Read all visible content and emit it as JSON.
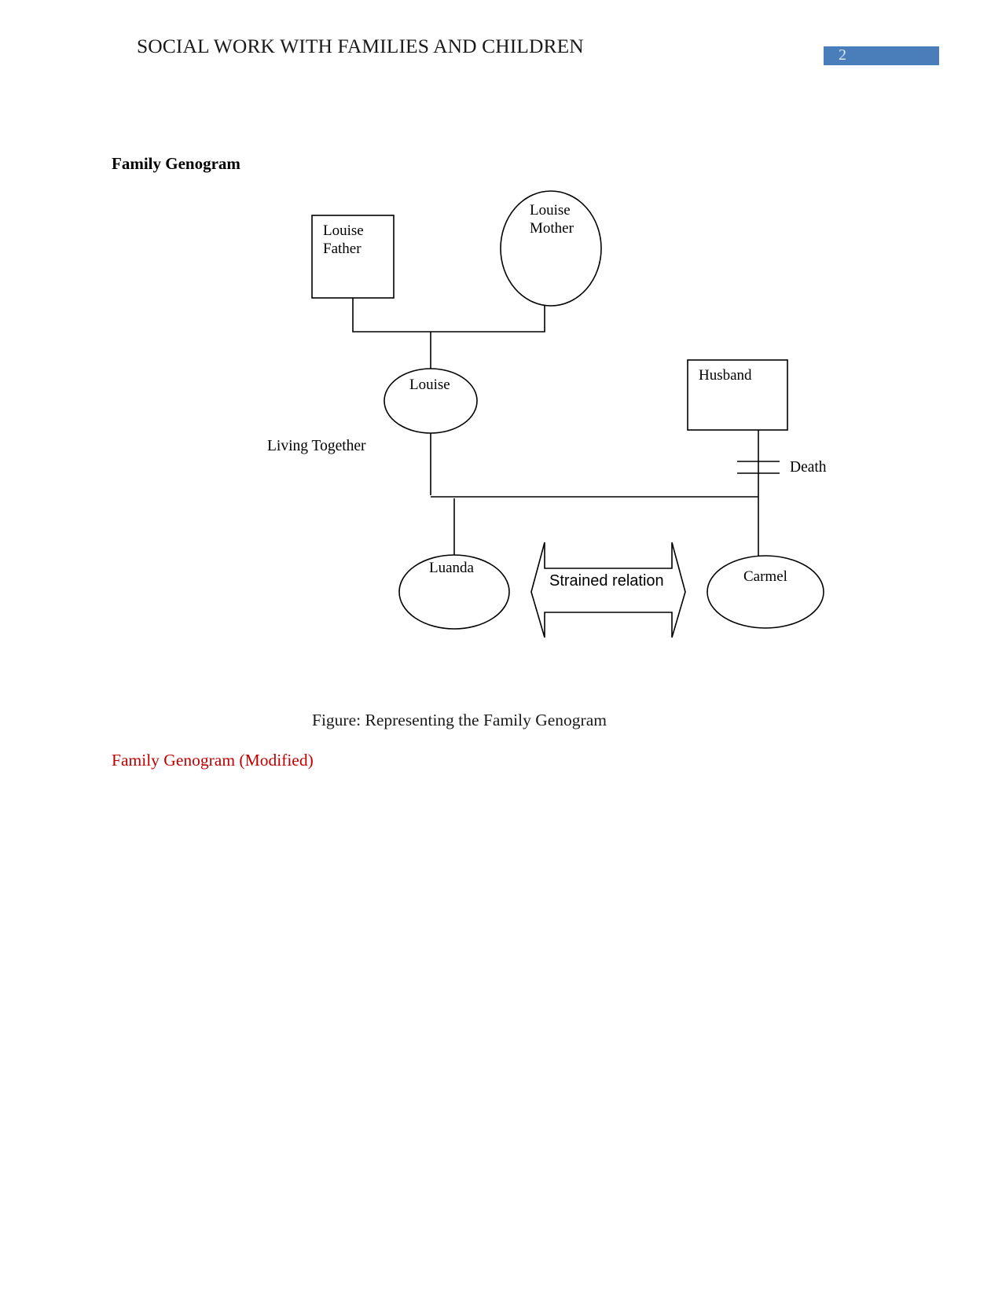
{
  "document": {
    "header_title": "SOCIAL WORK WITH FAMILIES AND CHILDREN",
    "page_number": "2",
    "page_number_badge_color": "#4a7ebb",
    "section_heading": "Family Genogram",
    "figure_caption": "Figure: Representing the Family Genogram",
    "modified_heading": "Family Genogram (Modified)",
    "modified_heading_color": "#c00000"
  },
  "genogram": {
    "nodes": [
      {
        "id": "louise-father",
        "label": "Louise\nFather",
        "shape": "rectangle"
      },
      {
        "id": "louise-mother",
        "label": "Louise\nMother",
        "shape": "circle"
      },
      {
        "id": "louise",
        "label": "Louise",
        "shape": "ellipse"
      },
      {
        "id": "husband",
        "label": "Husband",
        "shape": "rectangle"
      },
      {
        "id": "luanda",
        "label": "Luanda",
        "shape": "ellipse"
      },
      {
        "id": "carmel",
        "label": "Carmel",
        "shape": "ellipse"
      }
    ],
    "relations": [
      {
        "id": "living-together",
        "label": "Living Together"
      },
      {
        "id": "death",
        "label": "Death"
      },
      {
        "id": "strained-relation",
        "label": "Strained relation"
      }
    ]
  }
}
